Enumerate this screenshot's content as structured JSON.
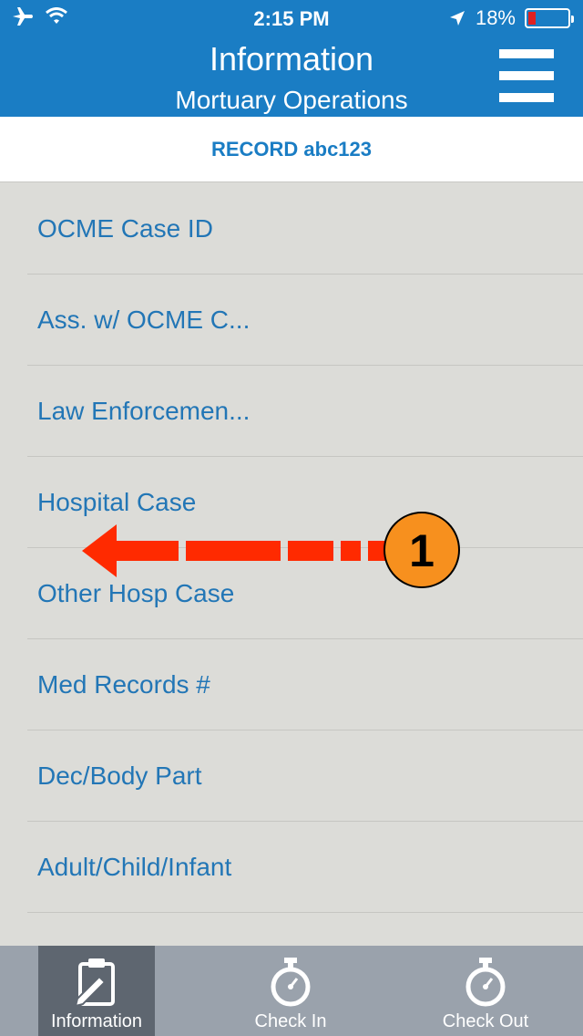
{
  "status_bar": {
    "time": "2:15 PM",
    "battery": "18%",
    "battery_level": 0.18
  },
  "header": {
    "title": "Information",
    "subtitle": "Mortuary Operations"
  },
  "record": {
    "label": "RECORD abc123"
  },
  "list": {
    "items": [
      {
        "label": "OCME Case ID"
      },
      {
        "label": "Ass. w/ OCME C..."
      },
      {
        "label": "Law Enforcemen..."
      },
      {
        "label": "Hospital Case"
      },
      {
        "label": "Other Hosp Case"
      },
      {
        "label": "Med Records #"
      },
      {
        "label": "Dec/Body Part"
      },
      {
        "label": "Adult/Child/Infant"
      }
    ]
  },
  "annotation": {
    "step_number": "1"
  },
  "tabs": [
    {
      "label": "Information",
      "icon": "clipboard-pencil-icon"
    },
    {
      "label": "Check In",
      "icon": "stopwatch-icon"
    },
    {
      "label": "Check Out",
      "icon": "stopwatch-icon"
    }
  ],
  "colors": {
    "header": "#1a7dc4",
    "list_text": "#2276b6",
    "background": "#dcdcd8",
    "tabbar": "#9aa2ac",
    "tab_active": "#5e6670",
    "annotation_arrow": "#ff2a00",
    "annotation_badge": "#f7901e"
  }
}
